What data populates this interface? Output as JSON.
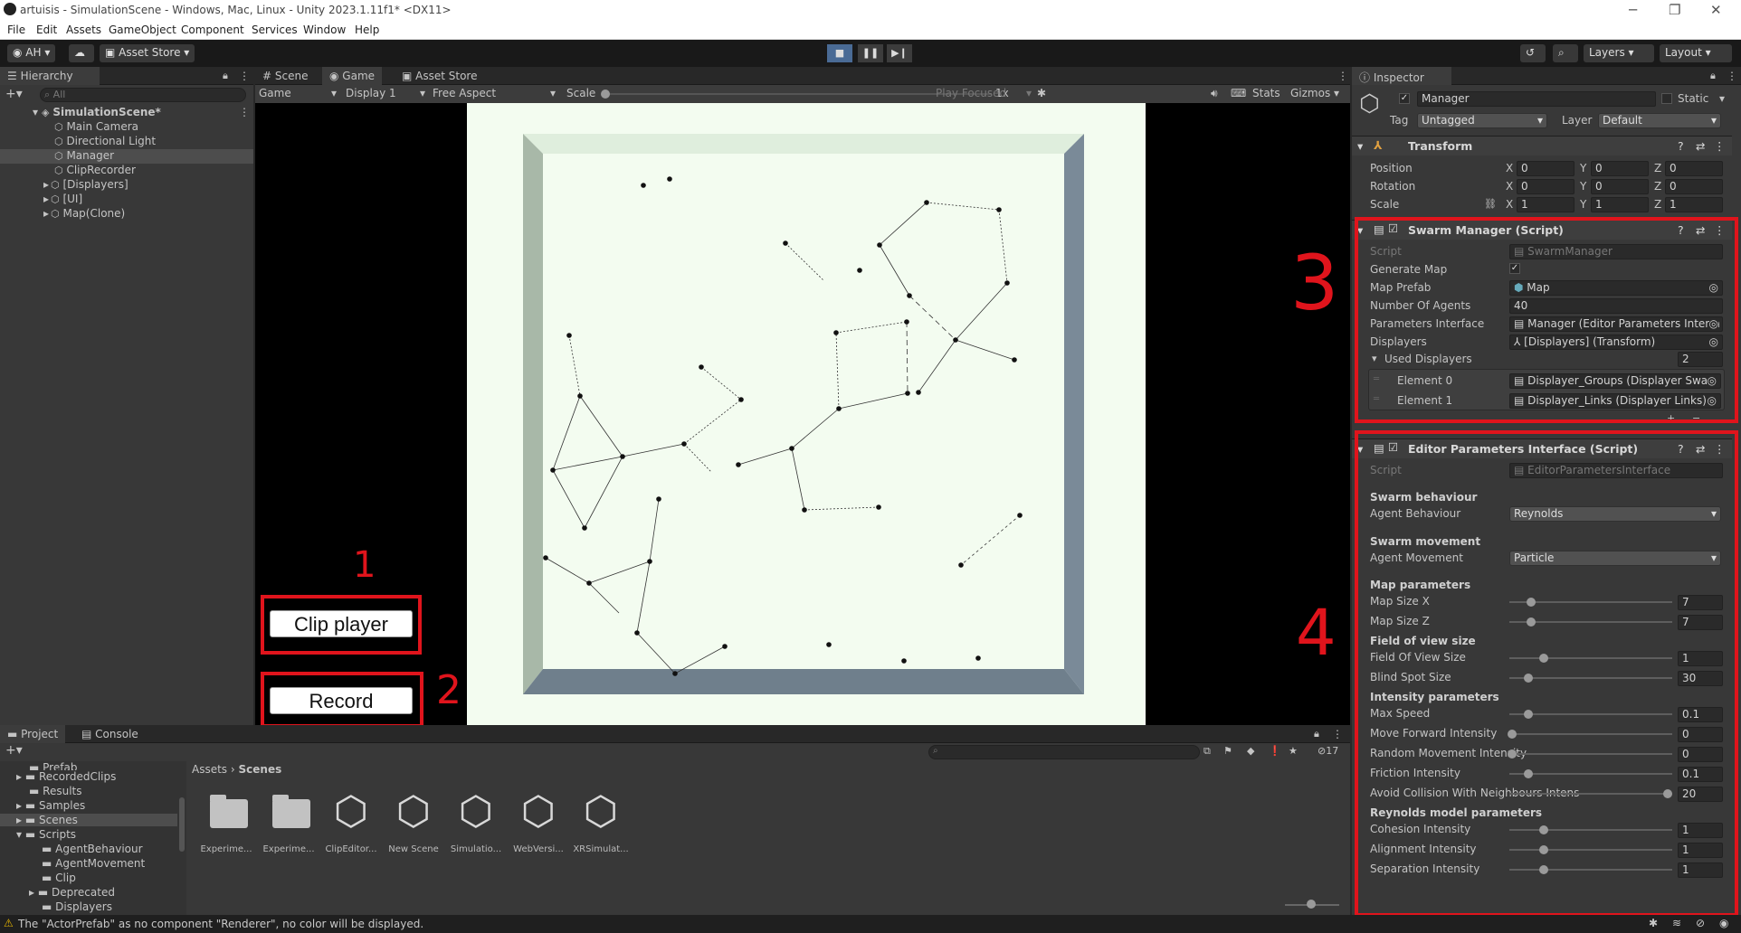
{
  "window": {
    "title": "artuisis - SimulationScene - Windows, Mac, Linux - Unity 2023.1.11f1* <DX11>",
    "min": "─",
    "max": "❐",
    "close": "✕"
  },
  "menu": [
    "File",
    "Edit",
    "Assets",
    "GameObject",
    "Component",
    "Services",
    "Window",
    "Help"
  ],
  "toolbar": {
    "account": "AH ▾",
    "asset_store": "Asset Store ▾",
    "layers": "Layers",
    "layout": "Layout"
  },
  "hierarchy": {
    "tab": "Hierarchy",
    "search_placeholder": "All",
    "scene": "SimulationScene*",
    "items": [
      "Main Camera",
      "Directional Light",
      "Manager",
      "ClipRecorder",
      "[Displayers]",
      "[UI]",
      "Map(Clone)"
    ]
  },
  "center_tabs": [
    "Scene",
    "Game",
    "Asset Store"
  ],
  "game_bar": {
    "view": "Game",
    "display": "Display 1",
    "aspect": "Free Aspect",
    "scale_label": "Scale",
    "scale_value": "1x",
    "play_mode": "Play Focused",
    "stats": "Stats",
    "gizmos": "Gizmos"
  },
  "game_buttons": {
    "clip_player": "Clip player",
    "record": "Record"
  },
  "annotations": [
    "1",
    "2",
    "3",
    "4"
  ],
  "inspector": {
    "tab": "Inspector",
    "object_name": "Manager",
    "static": "Static",
    "tag_label": "Tag",
    "tag": "Untagged",
    "layer_label": "Layer",
    "layer": "Default",
    "transform": {
      "title": "Transform",
      "rows": [
        {
          "label": "Position",
          "x": "0",
          "y": "0",
          "z": "0"
        },
        {
          "label": "Rotation",
          "x": "0",
          "y": "0",
          "z": "0"
        },
        {
          "label": "Scale",
          "x": "1",
          "y": "1",
          "z": "1"
        }
      ]
    },
    "swarm_manager": {
      "title": "Swarm Manager (Script)",
      "script_label": "Script",
      "script": "SwarmManager",
      "generate_map_label": "Generate Map",
      "map_prefab_label": "Map Prefab",
      "map_prefab": "Map",
      "agents_label": "Number Of Agents",
      "agents": "40",
      "params_label": "Parameters Interface",
      "params": "Manager (Editor Parameters Interfa",
      "displayers_label": "Displayers",
      "displayers": "[Displayers] (Transform)",
      "used_label": "Used Displayers",
      "used_count": "2",
      "elements": [
        {
          "label": "Element 0",
          "value": "Displayer_Groups (Displayer Swarr"
        },
        {
          "label": "Element 1",
          "value": "Displayer_Links (Displayer Links)"
        }
      ]
    },
    "editor_params": {
      "title": "Editor Parameters Interface (Script)",
      "script_label": "Script",
      "script": "EditorParametersInterface",
      "swarm_behaviour": "Swarm behaviour",
      "agent_behaviour_label": "Agent Behaviour",
      "agent_behaviour": "Reynolds",
      "swarm_movement": "Swarm movement",
      "agent_movement_label": "Agent Movement",
      "agent_movement": "Particle",
      "sliders": [
        {
          "section": "Map parameters",
          "label": "Map Size X",
          "value": "7",
          "fraction": 0.12
        },
        {
          "section": "",
          "label": "Map Size Z",
          "value": "7",
          "fraction": 0.12
        },
        {
          "section": "Field of view size",
          "label": "Field Of View Size",
          "value": "1",
          "fraction": 0.2
        },
        {
          "section": "",
          "label": "Blind Spot Size",
          "value": "30",
          "fraction": 0.1
        },
        {
          "section": "Intensity parameters",
          "label": "Max Speed",
          "value": "0.1",
          "fraction": 0.1
        },
        {
          "section": "",
          "label": "Move Forward Intensity",
          "value": "0",
          "fraction": 0.0
        },
        {
          "section": "",
          "label": "Random Movement Intensity",
          "value": "0",
          "fraction": 0.0
        },
        {
          "section": "",
          "label": "Friction Intensity",
          "value": "0.1",
          "fraction": 0.1
        },
        {
          "section": "",
          "label": "Avoid Collision With Neighbours Intensity",
          "value": "20",
          "fraction": 0.98
        },
        {
          "section": "Reynolds model parameters",
          "label": "Cohesion Intensity",
          "value": "1",
          "fraction": 0.2
        },
        {
          "section": "",
          "label": "Alignment Intensity",
          "value": "1",
          "fraction": 0.2
        },
        {
          "section": "",
          "label": "Separation Intensity",
          "value": "1",
          "fraction": 0.2
        }
      ]
    }
  },
  "project": {
    "tabs": [
      "Project",
      "Console"
    ],
    "tree": [
      "Prefab",
      "RecordedClips",
      "Results",
      "Samples",
      "Scenes",
      "Scripts",
      "AgentBehaviour",
      "AgentMovement",
      "Clip",
      "Deprecated",
      "Displayers"
    ],
    "breadcrumb": [
      "Assets",
      "Scenes"
    ],
    "hidden_count": "17",
    "assets": [
      {
        "name": "Experime...",
        "kind": "folder"
      },
      {
        "name": "Experime...",
        "kind": "folder"
      },
      {
        "name": "ClipEditor...",
        "kind": "unity"
      },
      {
        "name": "New Scene",
        "kind": "unity"
      },
      {
        "name": "Simulatio...",
        "kind": "unity"
      },
      {
        "name": "WebVersi...",
        "kind": "unity"
      },
      {
        "name": "XRSimulat...",
        "kind": "unity"
      }
    ]
  },
  "status": {
    "message": "The \"ActorPrefab\" as no component \"Renderer\", no color will be displayed."
  },
  "colors": {
    "accent_red": "#e0141c",
    "game_bg": "#f3fcf0",
    "editor_bg": "#383838"
  }
}
